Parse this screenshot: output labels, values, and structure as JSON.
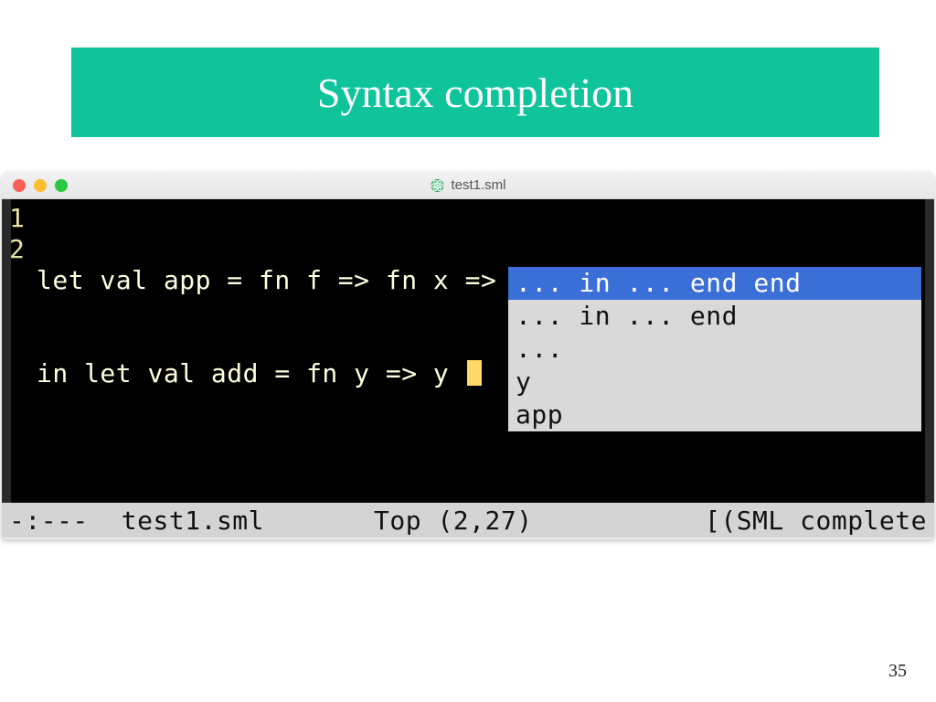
{
  "slide": {
    "title": "Syntax completion",
    "page_number": "35"
  },
  "window": {
    "filename": "test1.sml"
  },
  "editor": {
    "line_numbers": [
      "1",
      "2"
    ],
    "lines": [
      "let val app = fn f => fn x => f x",
      "in let val add = fn y => y "
    ]
  },
  "completion": {
    "items": [
      "... in ... end end",
      "... in ... end",
      "...",
      "y",
      "app"
    ],
    "selected_index": 0
  },
  "modeline": {
    "status": "-:---",
    "buffer": "test1.sml",
    "position": "Top (2,27)",
    "mode": "[(SML complete"
  }
}
